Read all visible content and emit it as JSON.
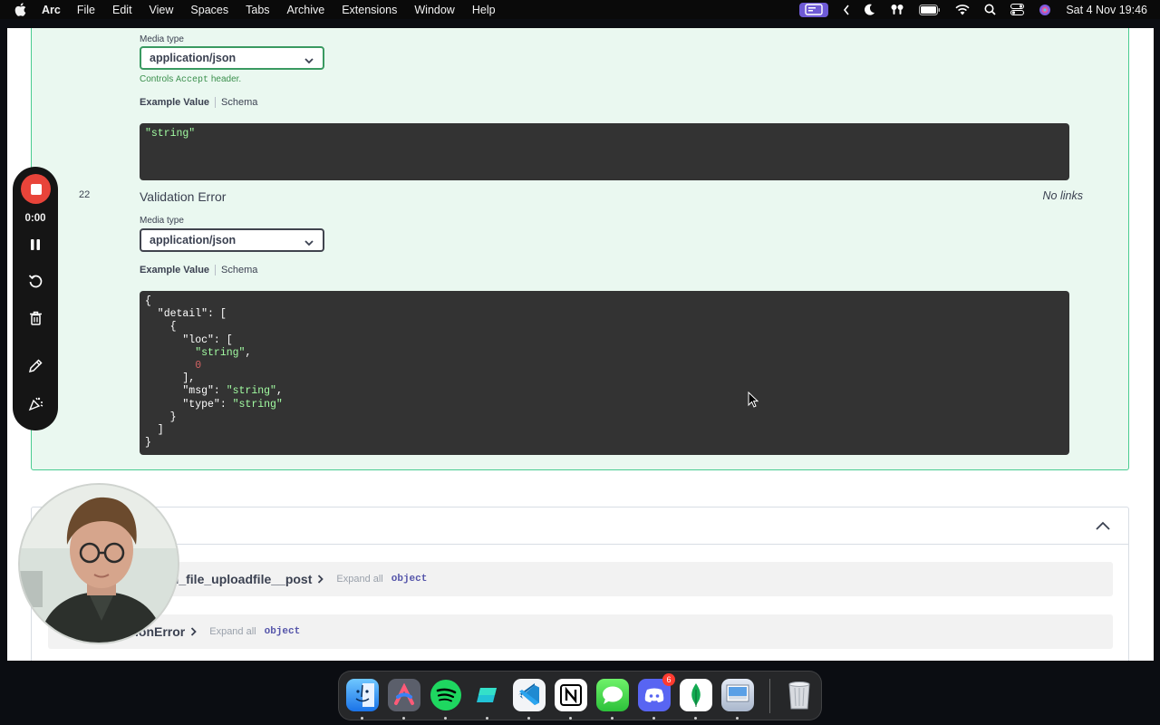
{
  "menubar": {
    "app_name": "Arc",
    "items": [
      "File",
      "Edit",
      "View",
      "Spaces",
      "Tabs",
      "Archive",
      "Extensions",
      "Window",
      "Help"
    ],
    "datetime": "Sat 4 Nov  19:46"
  },
  "response_200": {
    "media_type_label": "Media type",
    "media_type_value": "application/json",
    "accept_note_prefix": "Controls",
    "accept_note_code": "Accept",
    "accept_note_suffix": "header.",
    "tab_example": "Example Value",
    "tab_schema": "Schema",
    "example_code": "\"string\""
  },
  "response_422": {
    "code": "22",
    "description": "Validation Error",
    "links": "No links",
    "media_type_label": "Media type",
    "media_type_value": "application/json",
    "tab_example": "Example Value",
    "tab_schema": "Schema"
  },
  "schemas": {
    "models": [
      {
        "name": "ad_file_uploadfile__post",
        "expand": "Expand all",
        "type": "object"
      },
      {
        "name": "ionError",
        "expand": "Expand all",
        "type": "object"
      }
    ]
  },
  "recorder": {
    "time": "0:00"
  },
  "dock": {
    "discord_badge": "6"
  }
}
